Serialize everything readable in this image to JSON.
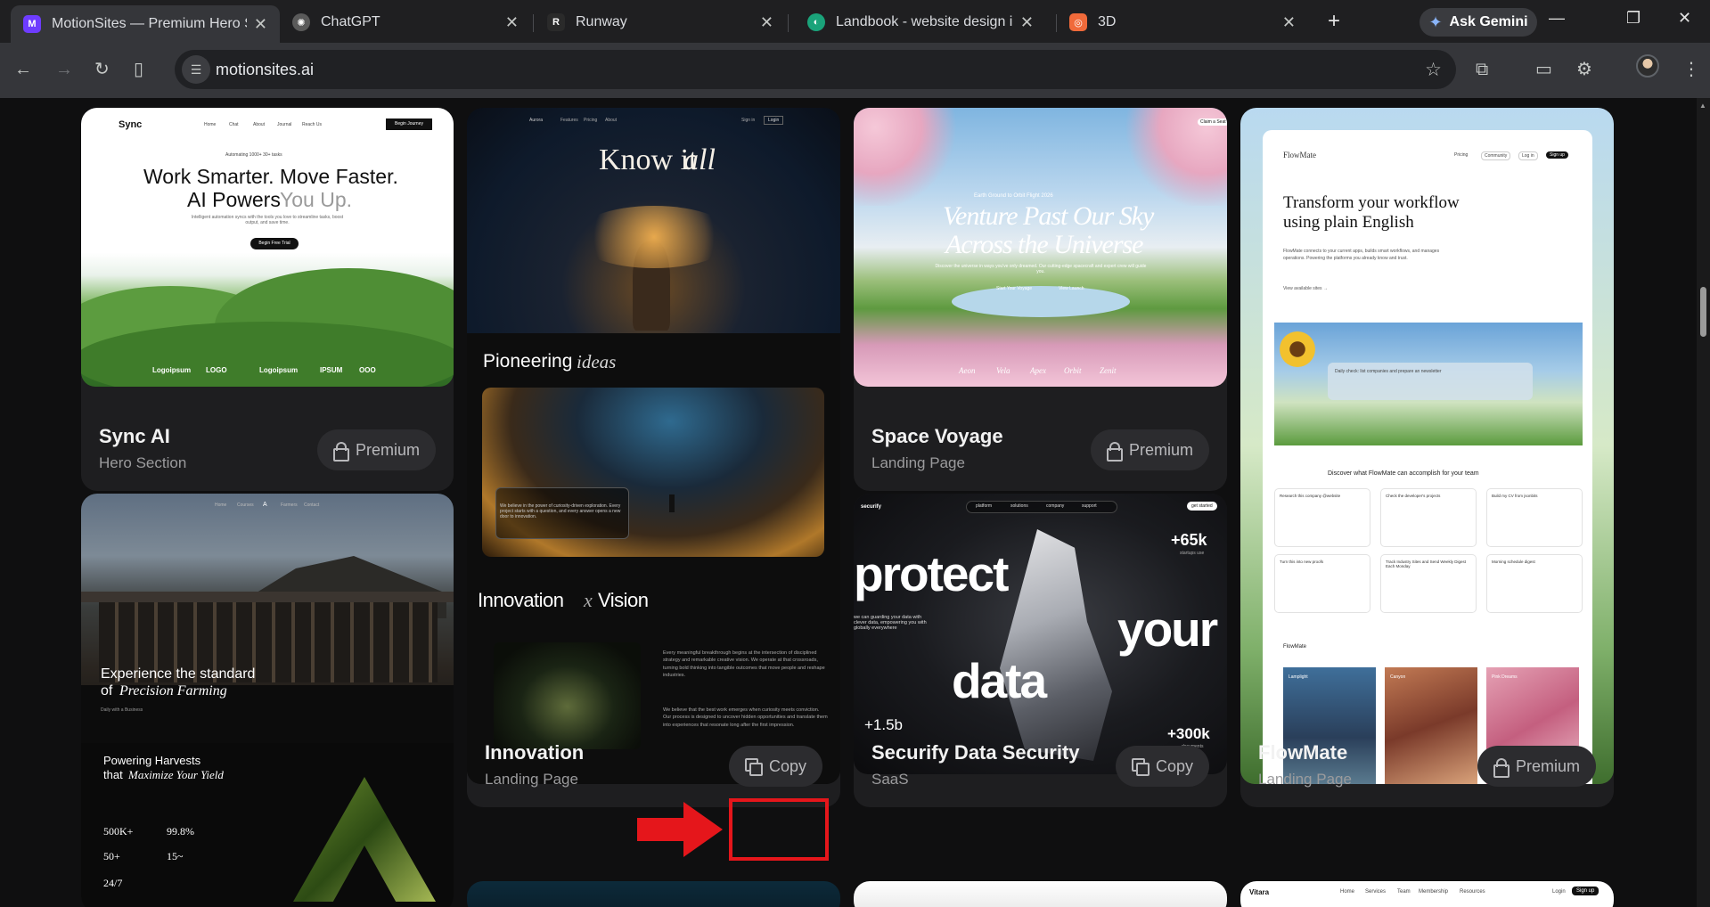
{
  "browser": {
    "tabs": [
      {
        "title": "MotionSites — Premium Hero S",
        "favicon": "motionsites-logo-icon",
        "color": "#6e3cff"
      },
      {
        "title": "ChatGPT",
        "favicon": "chatgpt-logo-icon",
        "color": "#444"
      },
      {
        "title": "Runway",
        "favicon": "runway-logo-icon",
        "color": "#222"
      },
      {
        "title": "Landbook - website design insp",
        "favicon": "landbook-logo-icon",
        "color": "#1aa37a"
      },
      {
        "title": "3D",
        "favicon": "3d-logo-icon",
        "color": "#f06a3a"
      }
    ],
    "gemini_label": "Ask Gemini",
    "url": "motionsites.ai"
  },
  "cards": {
    "sync": {
      "title": "Sync AI",
      "subtitle": "Hero Section",
      "badge": "Premium",
      "preview": {
        "brand": "Sync",
        "nav": [
          "Home",
          "Chat",
          "About",
          "Journal",
          "Reach Us"
        ],
        "cta": "Begin Journey",
        "tag": "Automating 1000+ 30+ tasks",
        "headline1": "Work Smarter. Move Faster.",
        "headline2a": "AI Powers",
        "headline2b": "You Up.",
        "body": "Intelligent automation syncs with the tools you love to streamline tasks, boost output, and save time.",
        "button": "Begin Free Trial",
        "logos": [
          "Logoipsum",
          "LOGO",
          "Logoipsum",
          "IPSUM",
          "OOO"
        ]
      }
    },
    "innovation": {
      "title": "Innovation",
      "subtitle": "Landing Page",
      "badge": "Copy",
      "preview": {
        "nav_brand": "Aurora",
        "nav": [
          "Features",
          "Pricing",
          "About"
        ],
        "signin": "Sign in",
        "login": "Login",
        "headline": "Know it",
        "headline_it": "all",
        "section1": "Pioneering",
        "section1_it": "ideas",
        "section2a": "Innovation",
        "section2x": "x",
        "section2b": "Vision",
        "body1": "We believe in the power of curiosity-driven exploration. Every project starts with a question, and every answer opens a new door to innovation.",
        "body2": "Every meaningful breakthrough begins at the intersection of disciplined strategy and remarkable creative vision. We operate at that crossroads, turning bold thinking into tangible outcomes that move people and reshape industries.",
        "body3": "We believe that the best work emerges when curiosity meets conviction. Our process is designed to uncover hidden opportunities and translate them into experiences that resonate long after the first impression."
      }
    },
    "space": {
      "title": "Space Voyage",
      "subtitle": "Landing Page",
      "badge": "Premium",
      "preview": {
        "headline1": "Venture Past Our Sky",
        "headline2": "Across the Universe",
        "tag": "Earth Ground to Orbit Flight 2026",
        "body": "Discover the universe in ways you've only dreamed. Our cutting-edge spacecraft and expert crew will guide you.",
        "btn1": "Start Your Voyage",
        "btn2": "View Launch",
        "names": [
          "Aeon",
          "Vela",
          "Apex",
          "Orbit",
          "Zenit"
        ],
        "cta": "Claim a Seat"
      }
    },
    "securify": {
      "title": "Securify Data Security",
      "subtitle": "SaaS",
      "badge": "Copy",
      "preview": {
        "brand": "securify",
        "nav": [
          "platform",
          "solutions",
          "company",
          "support"
        ],
        "cta": "get started",
        "w1": "protect",
        "w2": "your",
        "w3": "data",
        "stat1": "+65k",
        "stat1_sub": "startups use",
        "stat2": "+1.5b",
        "stat3": "+300k",
        "stat3_sub": "documents",
        "body": "we can guarding your data with clever data, empowering you with globally everywhere"
      }
    },
    "flowmate": {
      "title": "FlowMate",
      "subtitle": "Landing Page",
      "badge": "Premium",
      "preview": {
        "brand": "FlowMate",
        "nav": [
          "Pricing",
          "Community",
          "Log in",
          "Sign up"
        ],
        "headline1": "Transform your workflow",
        "headline2": "using plain English",
        "body": "FlowMate connects to your current apps, builds smart workflows, and manages operations. Powering the platforms you already know and trust.",
        "link": "View available sites →",
        "prompt": "Daily check: list companies and prepare an newsletter",
        "discover": "Discover what FlowMate can accomplish for your team",
        "tiles": [
          "Research this company @website",
          "Check the developer's projects",
          "Build my CV from jsonbits",
          "Turn this into new proofs",
          "Track Industry Sites and Send Weekly Digest Each Monday",
          "Morning schedule digest"
        ],
        "gallery_label": "FlowMate",
        "gallery": [
          "Lamplight",
          "Canyon",
          "Pink Dreams"
        ]
      }
    },
    "harvest": {
      "preview": {
        "nav": [
          "Home",
          "Courses",
          "A",
          "Farmers",
          "Contact"
        ],
        "headline1": "Experience the standard",
        "headline2": "of",
        "headline2_it": "Precision Farming",
        "tag": "Daily with a Business",
        "section1": "Powering Harvests",
        "section2": "that",
        "section2_it": "Maximize Your Yield",
        "stats": [
          "500K+",
          "99.8%",
          "50+",
          "15~",
          "24/7"
        ]
      }
    },
    "vitara": {
      "preview": {
        "brand": "Vitara",
        "nav": [
          "Home",
          "Services",
          "Team",
          "Membership",
          "Resources"
        ],
        "login": "Login",
        "signup": "Sign up"
      }
    }
  },
  "colors": {
    "highlight": "#e5161b",
    "card_bg": "#1e1e20",
    "pill_bg": "#2c2c2f"
  }
}
